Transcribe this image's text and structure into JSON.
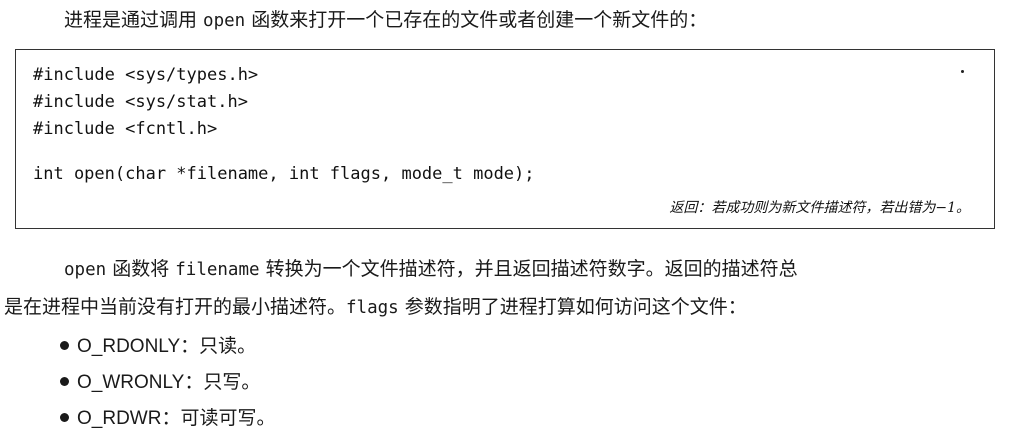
{
  "intro": {
    "before": "进程是通过调用 ",
    "code": "open",
    "after": " 函数来打开一个已存在的文件或者创建一个新文件的："
  },
  "code_block": {
    "lines": [
      "#include <sys/types.h>",
      "#include <sys/stat.h>",
      "#include <fcntl.h>",
      "int open(char *filename, int flags, mode_t mode);"
    ],
    "returns": "返回：若成功则为新文件描述符，若出错为−1。"
  },
  "paragraph": {
    "code1": "open",
    "text1": " 函数将 ",
    "code2": "filename",
    "text2": " 转换为一个文件描述符，并且返回描述符数字。返回的描述符总",
    "text3": "是在进程中当前没有打开的最小描述符。",
    "code3": "flags",
    "text4": " 参数指明了进程打算如何访问这个文件："
  },
  "flags": [
    {
      "name": "O_RDONLY",
      "desc": "：只读。"
    },
    {
      "name": "O_WRONLY",
      "desc": "：只写。"
    },
    {
      "name": "O_RDWR",
      "desc": "：可读可写。"
    }
  ]
}
